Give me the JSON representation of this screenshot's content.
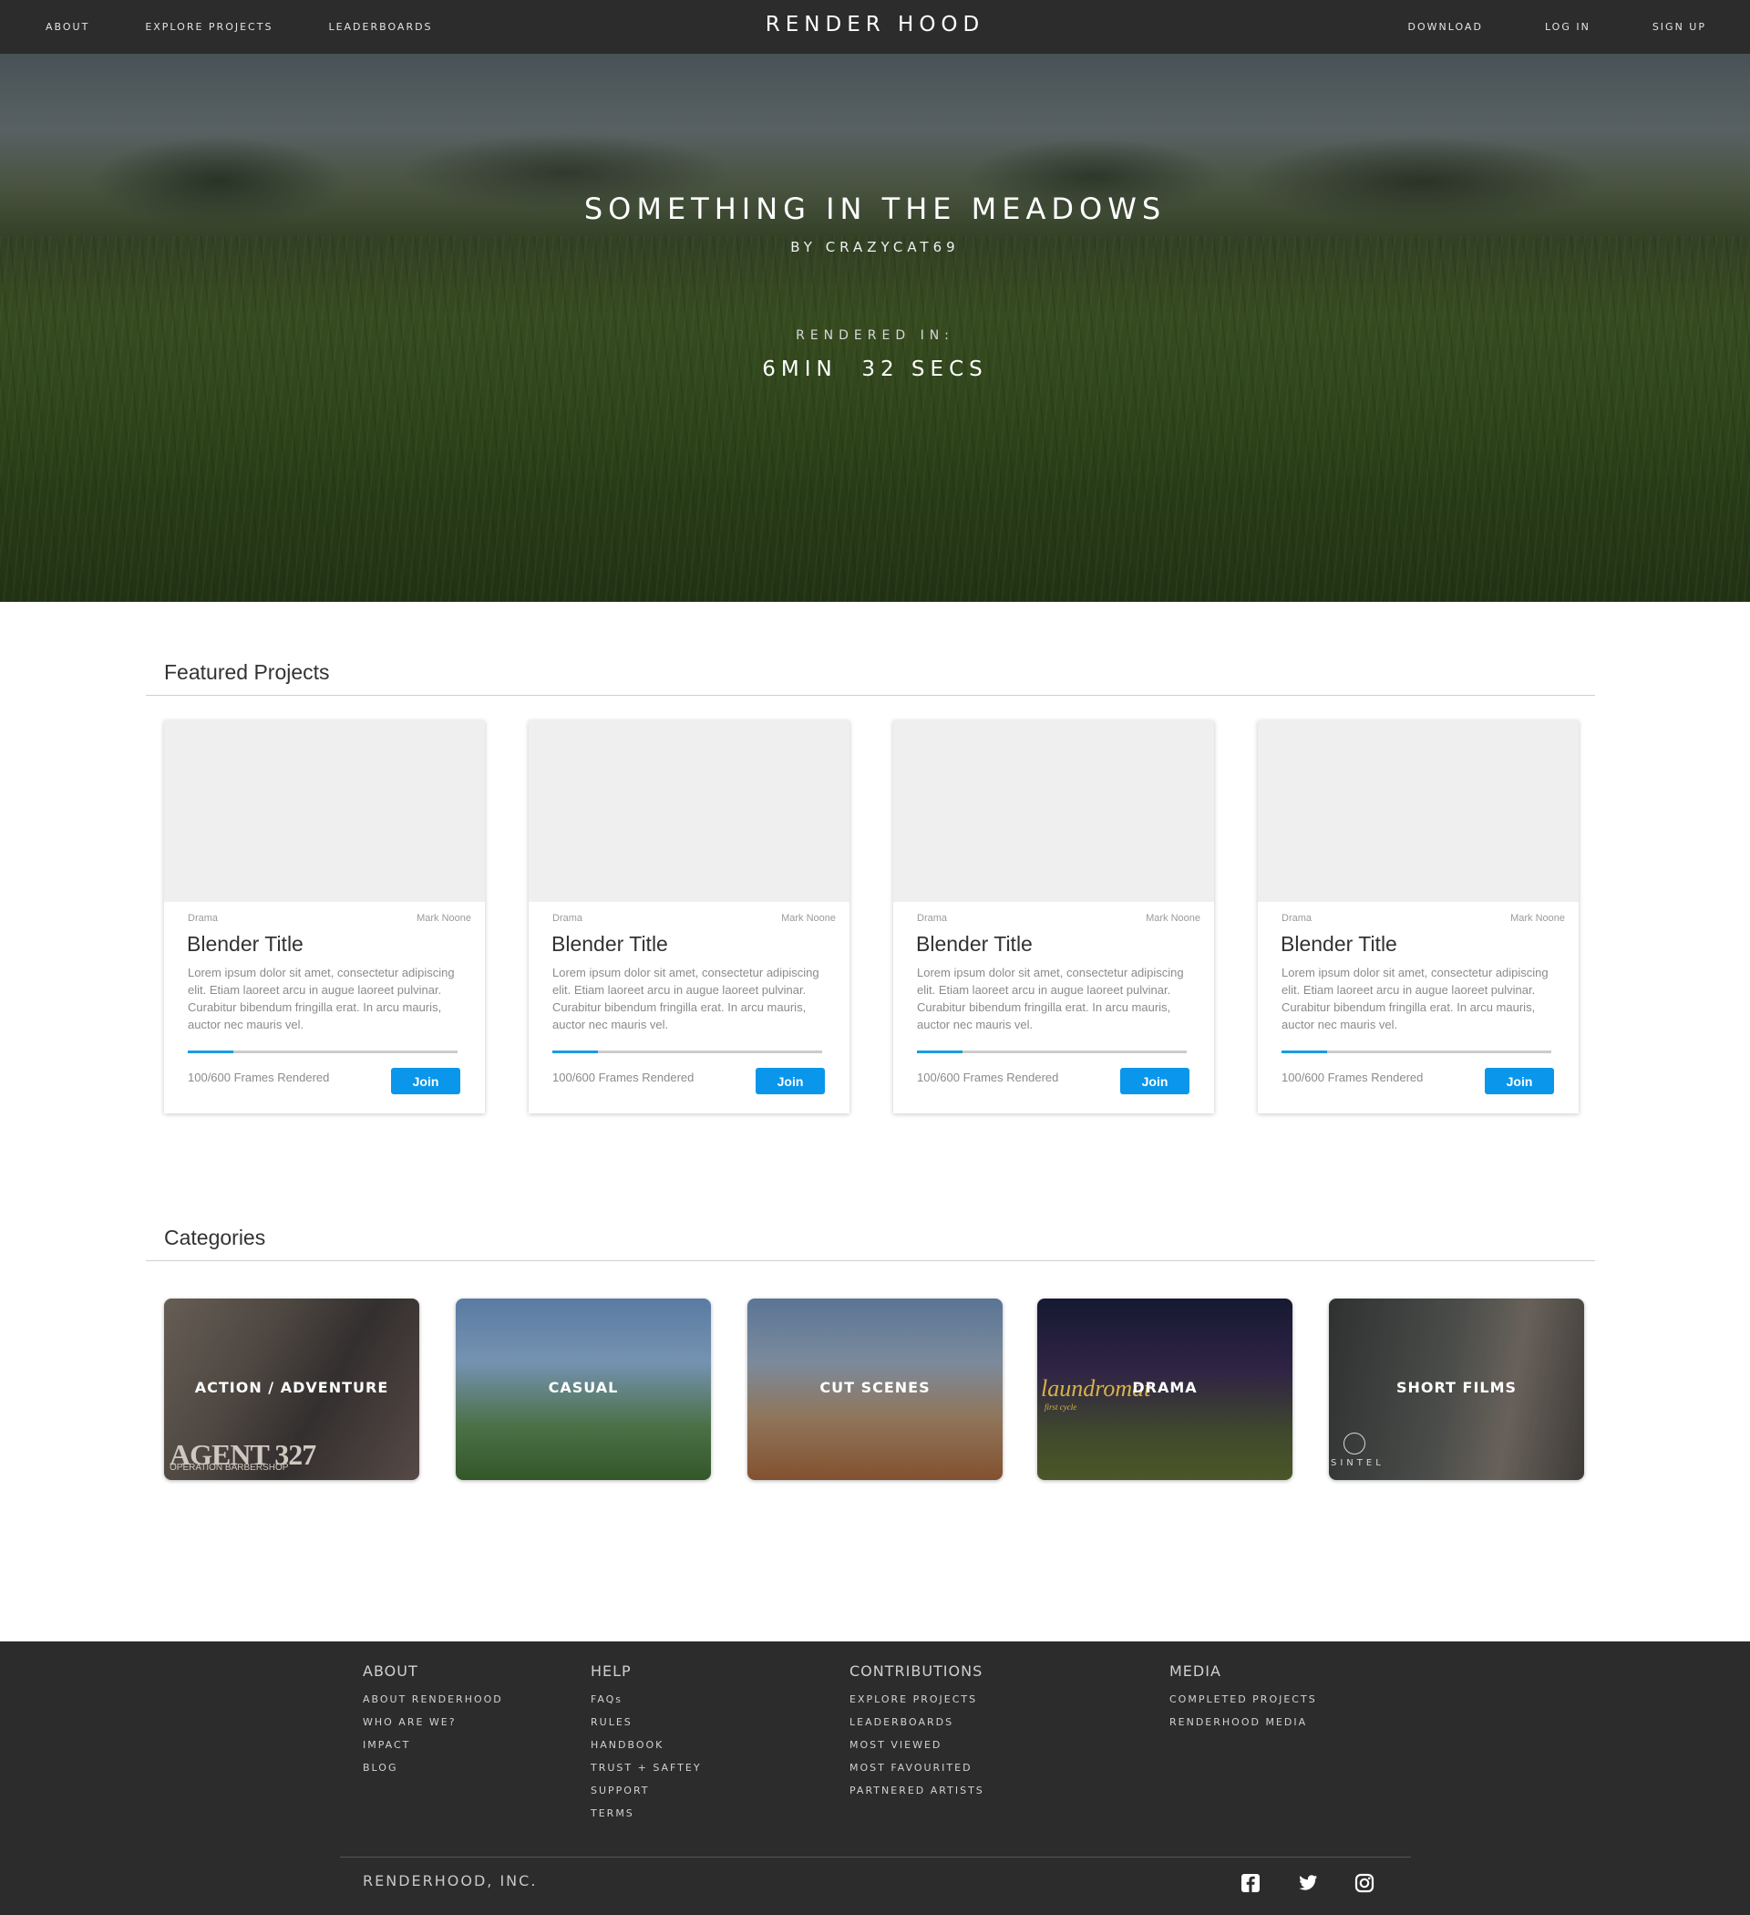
{
  "nav": {
    "left": [
      "ABOUT",
      "EXPLORE PROJECTS",
      "LEADERBOARDS"
    ],
    "brand": "RENDER HOOD",
    "right": [
      "DOWNLOAD",
      "LOG IN",
      "SIGN UP"
    ]
  },
  "hero": {
    "title": "SOMETHING IN THE MEADOWS",
    "author": "BY CRAZYCAT69",
    "rendered_label": "RENDERED IN:",
    "rendered_time": "6MIN  32 SECS"
  },
  "featured": {
    "title": "Featured Projects",
    "cards": [
      {
        "genre": "Drama",
        "author": "Mark Noone",
        "title": "Blender Title",
        "description": "Lorem ipsum dolor sit amet, consectetur adipiscing elit. Etiam laoreet arcu in augue laoreet pulvinar. Curabitur bibendum fringilla erat. In arcu mauris, auctor nec mauris vel.",
        "frames": "100/600 Frames Rendered",
        "progress": 0.17,
        "button": "Join"
      },
      {
        "genre": "Drama",
        "author": "Mark Noone",
        "title": "Blender Title",
        "description": "Lorem ipsum dolor sit amet, consectetur adipiscing elit. Etiam laoreet arcu in augue laoreet pulvinar. Curabitur bibendum fringilla erat. In arcu mauris, auctor nec mauris vel.",
        "frames": "100/600 Frames Rendered",
        "progress": 0.17,
        "button": "Join"
      },
      {
        "genre": "Drama",
        "author": "Mark Noone",
        "title": "Blender Title",
        "description": "Lorem ipsum dolor sit amet, consectetur adipiscing elit. Etiam laoreet arcu in augue laoreet pulvinar. Curabitur bibendum fringilla erat. In arcu mauris, auctor nec mauris vel.",
        "frames": "100/600 Frames Rendered",
        "progress": 0.17,
        "button": "Join"
      },
      {
        "genre": "Drama",
        "author": "Mark Noone",
        "title": "Blender Title",
        "description": "Lorem ipsum dolor sit amet, consectetur adipiscing elit. Etiam laoreet arcu in augue laoreet pulvinar. Curabitur bibendum fringilla erat. In arcu mauris, auctor nec mauris vel.",
        "frames": "100/600 Frames Rendered",
        "progress": 0.17,
        "button": "Join"
      }
    ]
  },
  "categories": {
    "title": "Categories",
    "items": [
      {
        "label": "ACTION / ADVENTURE",
        "logo": "AGENT 327",
        "logo_sub": "OPERATION BARBERSHOP"
      },
      {
        "label": "CASUAL"
      },
      {
        "label": "CUT SCENES"
      },
      {
        "label": "DRAMA",
        "logo": "laundromat",
        "logo_sub": "first cycle"
      },
      {
        "label": "SHORT FILMS",
        "logo": "SINTEL"
      }
    ]
  },
  "footer": {
    "columns": [
      {
        "heading": "ABOUT",
        "links": [
          "ABOUT RENDERHOOD",
          "WHO ARE WE?",
          "IMPACT",
          "BLOG"
        ]
      },
      {
        "heading": "HELP",
        "links": [
          "FAQs",
          "RULES",
          "HANDBOOK",
          "TRUST + SAFTEY",
          "SUPPORT",
          "TERMS"
        ]
      },
      {
        "heading": "CONTRIBUTIONS",
        "links": [
          "EXPLORE PROJECTS",
          "LEADERBOARDS",
          "MOST VIEWED",
          "MOST FAVOURITED",
          "PARTNERED ARTISTS"
        ]
      },
      {
        "heading": "MEDIA",
        "links": [
          "COMPLETED PROJECTS",
          "RENDERHOOD MEDIA"
        ]
      }
    ],
    "company": "RENDERHOOD, INC.",
    "social_icons": [
      "facebook-icon",
      "twitter-icon",
      "instagram-icon"
    ]
  },
  "colors": {
    "nav_bg": "#2c2c2c",
    "accent": "#0a96ea",
    "progress": "#1a9ce0"
  }
}
